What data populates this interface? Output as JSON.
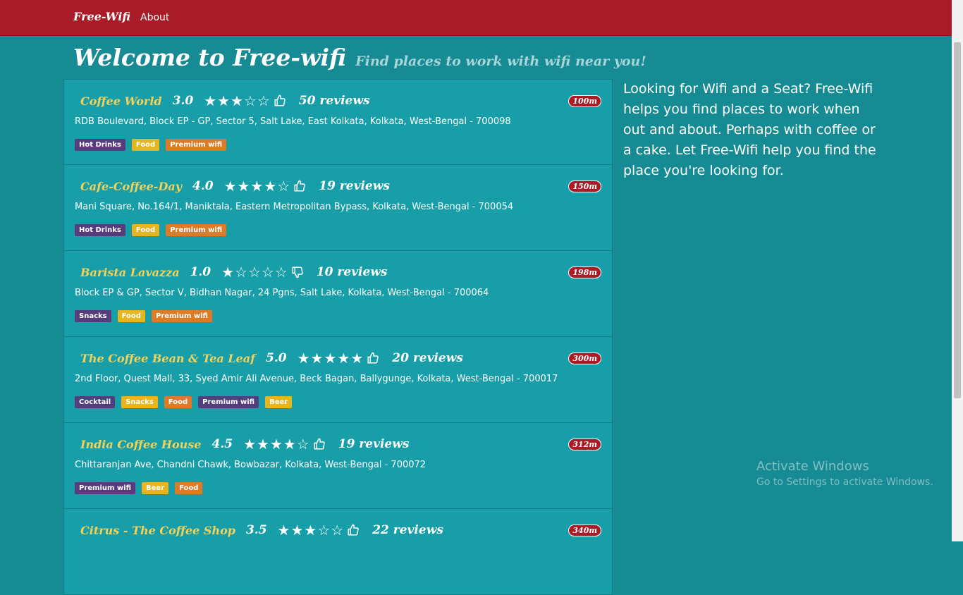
{
  "nav": {
    "brand": "Free-Wifi",
    "about": "About"
  },
  "header": {
    "title": "Welcome to Free-wifi",
    "subtitle": "Find places to work with wifi near you!"
  },
  "places": [
    {
      "name": "Coffee World",
      "rating": "3.0",
      "stars": "★★★☆☆",
      "thumb": "up",
      "reviews": "50 reviews",
      "address": "RDB Boulevard, Block EP - GP, Sector 5, Salt Lake, East Kolkata, Kolkata, West-Bengal - 700098",
      "distance": "100m",
      "tags": [
        {
          "label": "Hot Drinks",
          "color": "purple"
        },
        {
          "label": "Food",
          "color": "yellow"
        },
        {
          "label": "Premium wifi",
          "color": "orange"
        }
      ]
    },
    {
      "name": "Cafe-Coffee-Day",
      "rating": "4.0",
      "stars": "★★★★☆",
      "thumb": "up",
      "reviews": "19 reviews",
      "address": "Mani Square, No.164/1, Maniktala, Eastern Metropolitan Bypass, Kolkata, West-Bengal - 700054",
      "distance": "150m",
      "tags": [
        {
          "label": "Hot Drinks",
          "color": "purple"
        },
        {
          "label": "Food",
          "color": "yellow"
        },
        {
          "label": "Premium wifi",
          "color": "orange"
        }
      ]
    },
    {
      "name": "Barista Lavazza",
      "rating": "1.0",
      "stars": "★☆☆☆☆",
      "thumb": "down",
      "reviews": "10 reviews",
      "address": "Block EP & GP, Sector V, Bidhan Nagar, 24 Pgns, Salt Lake, Kolkata, West-Bengal - 700064",
      "distance": "198m",
      "tags": [
        {
          "label": "Snacks",
          "color": "purple"
        },
        {
          "label": "Food",
          "color": "yellow"
        },
        {
          "label": "Premium wifi",
          "color": "orange"
        }
      ]
    },
    {
      "name": "The Coffee Bean & Tea Leaf",
      "rating": "5.0",
      "stars": "★★★★★",
      "thumb": "up",
      "reviews": "20 reviews",
      "address": "2nd Floor, Quest Mall, 33, Syed Amir Ali Avenue, Beck Bagan, Ballygunge, Kolkata, West-Bengal - 700017",
      "distance": "300m",
      "tags": [
        {
          "label": "Cocktail",
          "color": "purple"
        },
        {
          "label": "Snacks",
          "color": "yellow"
        },
        {
          "label": "Food",
          "color": "orange"
        },
        {
          "label": "Premium wifi",
          "color": "purple"
        },
        {
          "label": "Beer",
          "color": "yellow"
        }
      ]
    },
    {
      "name": "India Coffee House",
      "rating": "4.5",
      "stars": "★★★★☆",
      "thumb": "up",
      "reviews": "19 reviews",
      "address": "Chittaranjan Ave, Chandni Chawk, Bowbazar, Kolkata, West-Bengal - 700072",
      "distance": "312m",
      "tags": [
        {
          "label": "Premium wifi",
          "color": "purple"
        },
        {
          "label": "Beer",
          "color": "yellow"
        },
        {
          "label": "Food",
          "color": "orange"
        }
      ]
    },
    {
      "name": "Citrus - The Coffee Shop",
      "rating": "3.5",
      "stars": "★★★☆☆",
      "thumb": "up",
      "reviews": "22 reviews",
      "address": "",
      "distance": "340m",
      "tags": []
    }
  ],
  "sidebar": {
    "text": "Looking for Wifi and a Seat? Free-Wifi helps you find places to work when out and about. Perhaps with coffee or a cake. Let Free-Wifi help you find the place you're looking for."
  },
  "watermark": {
    "title": "Activate Windows",
    "subtitle": "Go to Settings to activate Windows."
  },
  "colors": {
    "navbar": "#a91c27",
    "background": "#168b93",
    "card": "#179ea8",
    "place_name": "#f2d25b"
  }
}
